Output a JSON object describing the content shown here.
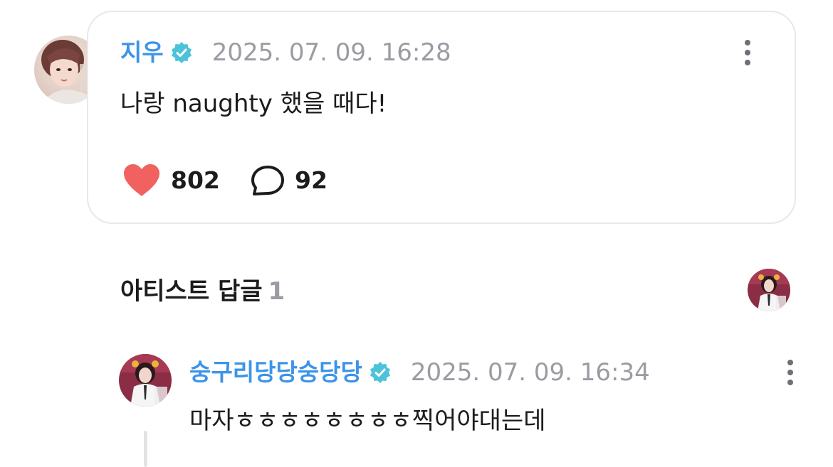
{
  "post": {
    "author": "지우",
    "timestamp": "2025. 07. 09. 16:28",
    "text": "나랑 naughty 했을 때다!",
    "likes": "802",
    "comments": "92"
  },
  "artist_replies": {
    "title": "아티스트 답글",
    "count": "1"
  },
  "reply": {
    "author": "숭구리당당숭당당",
    "timestamp": "2025. 07. 09. 16:34",
    "text": "마자ㅎㅎㅎㅎㅎㅎㅎㅎ찍어야대는데"
  },
  "colors": {
    "author_name": "#3d94e8",
    "verified_badge": "#4cc3d9",
    "like_heart": "#f0615f",
    "timestamp": "#9b9ba3",
    "card_border": "#e8e8ec"
  },
  "icons": [
    "verified-badge-icon",
    "more-options-icon",
    "heart-icon",
    "comment-bubble-icon"
  ]
}
